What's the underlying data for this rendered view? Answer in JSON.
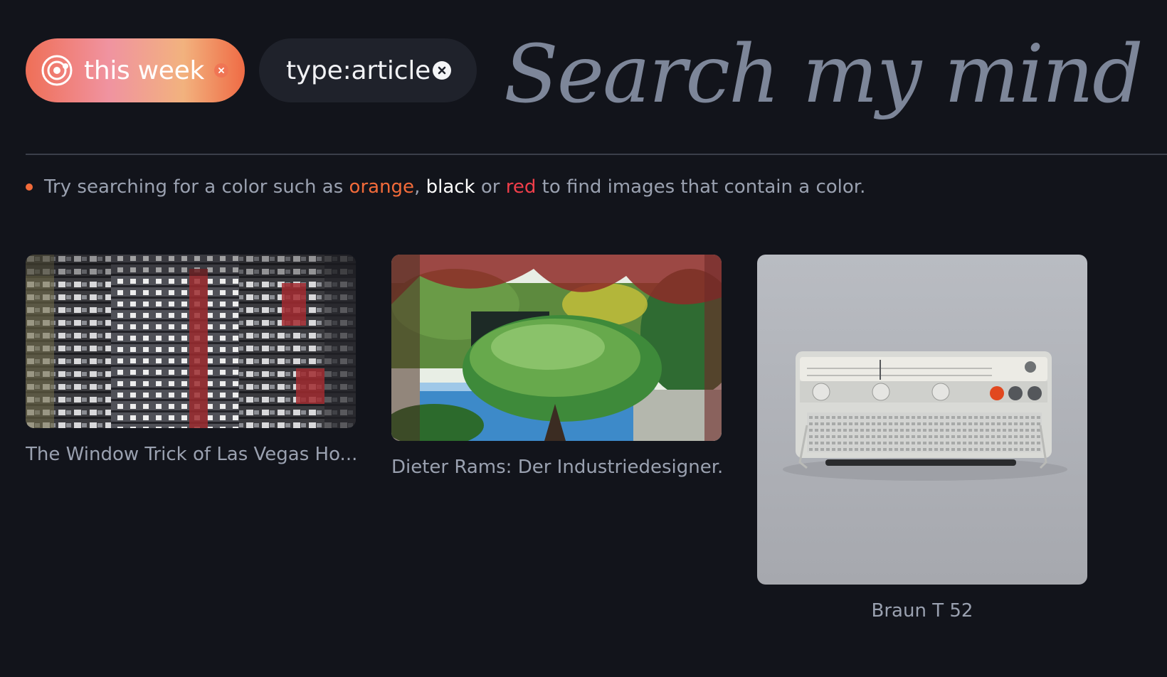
{
  "search": {
    "filters": [
      {
        "label": "this week",
        "style": "gradient"
      },
      {
        "label": "type:article",
        "style": "dark"
      }
    ],
    "placeholder": "Search my mind..."
  },
  "hint": {
    "prefix": "Try searching for a color such as",
    "color_orange": "orange",
    "separator_comma": ",",
    "color_black": "black",
    "word_or": "or",
    "color_red": "red",
    "suffix": "to find images that contain a color."
  },
  "colors": {
    "background": "#12141b",
    "accent_orange": "#f26b3a",
    "accent_red": "#ef3e4a",
    "chip_dark": "#1f222b",
    "muted_text": "#9aa1b0",
    "placeholder_text": "#7d8699"
  },
  "results": [
    {
      "title": "The Window Trick of Las Vegas Ho...",
      "image": "apartment-facade-photo"
    },
    {
      "title": "Dieter Rams: Der Industriedesigner...",
      "image": "garden-pool-photo"
    },
    {
      "title": "Braun T 52",
      "image": "braun-radio-photo"
    }
  ]
}
